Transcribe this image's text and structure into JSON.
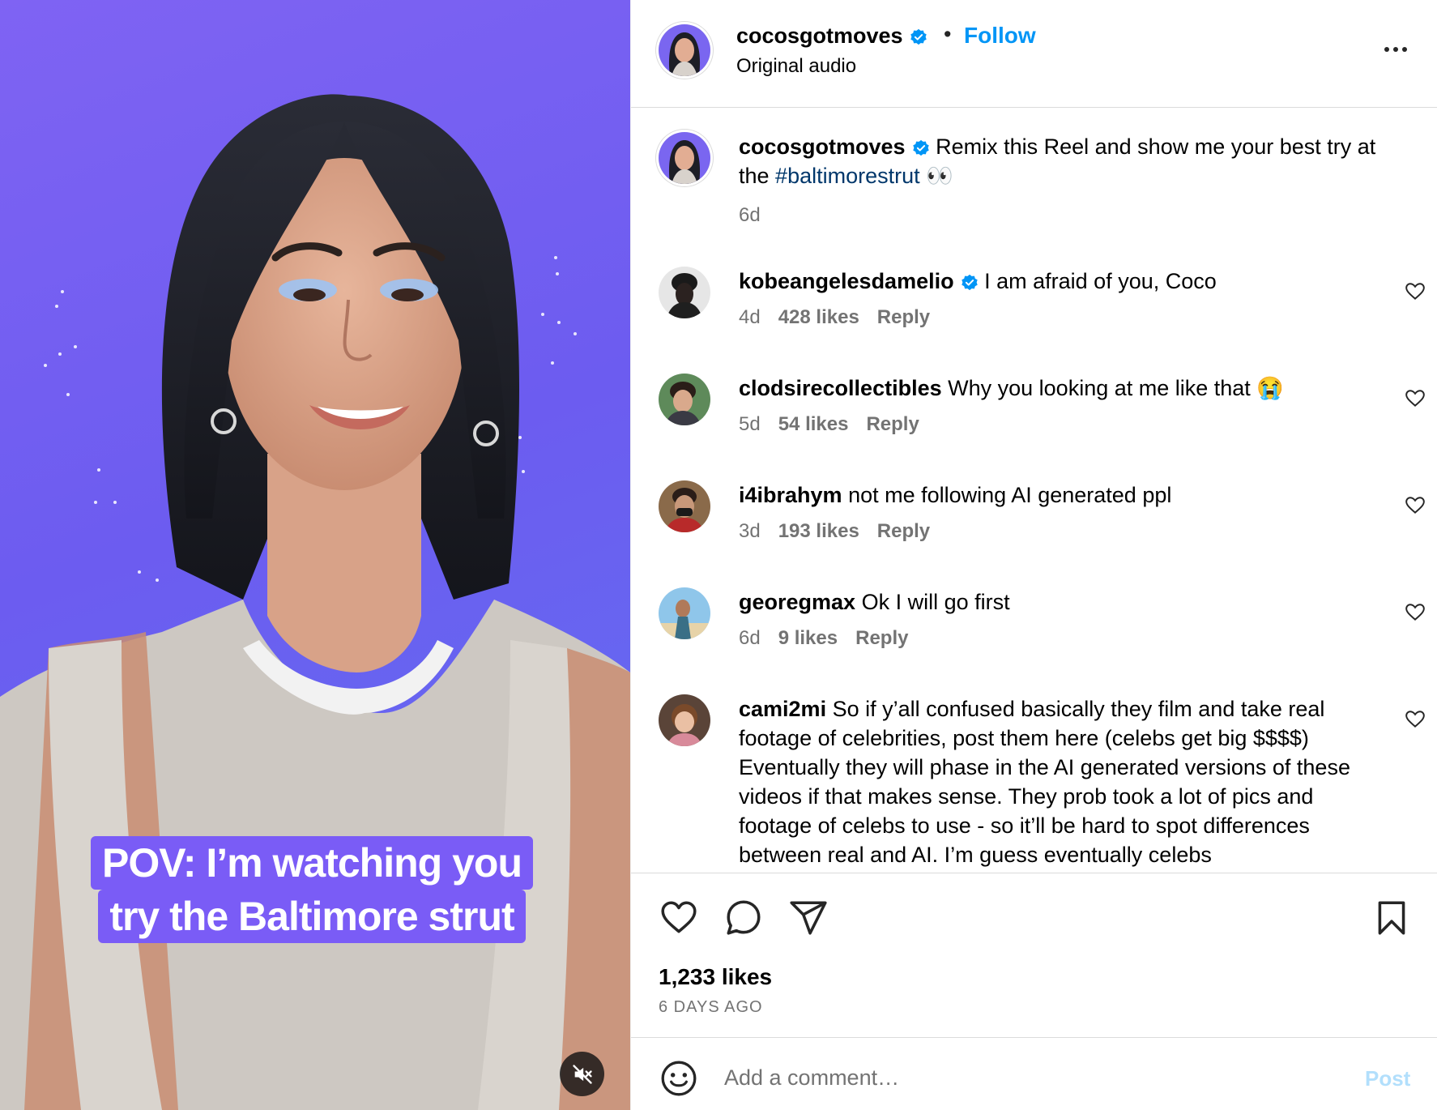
{
  "colors": {
    "accent": "#0095f6",
    "caption_bg": "#7a5cf6",
    "hashtag": "#00376b",
    "muted": "#737373"
  },
  "media": {
    "caption_line1": "POV: I’m watching you",
    "caption_line2": "try the Baltimore strut",
    "mute_icon": "volume-muted-icon"
  },
  "header": {
    "username": "cocosgotmoves",
    "separator": "•",
    "follow_label": "Follow",
    "audio_label": "Original audio",
    "more_icon": "more-options-icon"
  },
  "post_caption": {
    "username": "cocosgotmoves",
    "text_before": "Remix this Reel and show me your best try at the ",
    "hashtag": "#baltimorestrut",
    "text_after": " 👀",
    "age": "6d"
  },
  "comments": [
    {
      "username": "kobeangelesdamelio",
      "verified": true,
      "text": "I am afraid of you, Coco",
      "age": "4d",
      "likes": "428 likes",
      "reply": "Reply"
    },
    {
      "username": "clodsirecollectibles",
      "verified": false,
      "text": "Why you looking at me like that 😭",
      "age": "5d",
      "likes": "54 likes",
      "reply": "Reply"
    },
    {
      "username": "i4ibrahym",
      "verified": false,
      "text": "not me following AI generated ppl",
      "age": "3d",
      "likes": "193 likes",
      "reply": "Reply"
    },
    {
      "username": "georegmax",
      "verified": false,
      "text": "Ok I will go first",
      "age": "6d",
      "likes": "9 likes",
      "reply": "Reply"
    },
    {
      "username": "cami2mi",
      "verified": false,
      "text": "So if y’all confused basically they film and take real footage of celebrities, post them here (celebs get big $$$$) Eventually they will phase in the AI generated versions of these videos if that makes sense. They prob took a lot of pics and footage of celebs to use - so it’ll be hard to spot differences between real and AI. I’m guess eventually celebs"
    }
  ],
  "actions": {
    "icons": [
      "heart-icon",
      "comment-icon",
      "share-icon",
      "bookmark-icon"
    ],
    "likes_count": "1,233 likes",
    "posted_ago": "6 DAYS AGO"
  },
  "composer": {
    "placeholder": "Add a comment…",
    "post_label": "Post"
  }
}
